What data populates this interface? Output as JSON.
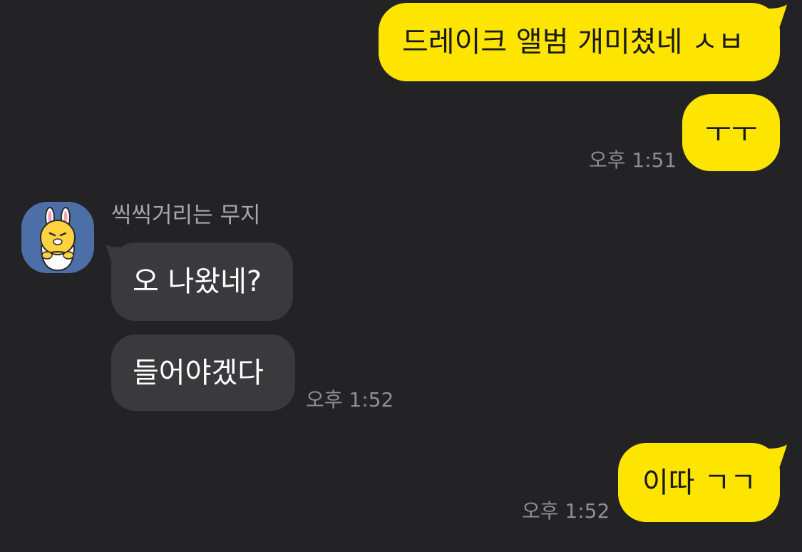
{
  "chat": {
    "messages": [
      {
        "direction": "outgoing",
        "text": "드레이크 앨범 개미쳤네 ㅅㅂ",
        "time": ""
      },
      {
        "direction": "outgoing",
        "text": "ㅜㅜ",
        "time": "오후 1:51"
      },
      {
        "direction": "incoming",
        "sender": "씩씩거리는 무지",
        "text": "오 나왔네?",
        "time": ""
      },
      {
        "direction": "incoming",
        "text": "들어야겠다",
        "time": "오후 1:52"
      },
      {
        "direction": "outgoing",
        "text": "이따 ㄱㄱ",
        "time": "오후 1:52"
      }
    ]
  },
  "avatar": {
    "icon": "muzi-character-icon",
    "background_color": "#4B6FA6"
  },
  "colors": {
    "background": "#232325",
    "outgoing_bubble": "#FEE500",
    "incoming_bubble": "#3A3A3C",
    "timestamp": "#8E8E93",
    "sender_name": "#A8A8AC"
  }
}
